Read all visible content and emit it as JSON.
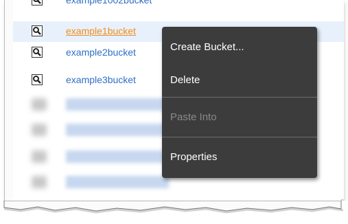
{
  "buckets": [
    {
      "name": "example1002bucket"
    },
    {
      "name": "example1bucket",
      "selected": true
    },
    {
      "name": "example2bucket"
    },
    {
      "name": "example3bucket"
    }
  ],
  "context_menu": {
    "create_bucket": "Create Bucket...",
    "delete": "Delete",
    "paste_into": "Paste Into",
    "properties": "Properties"
  },
  "icons": {
    "bucket_row": "magnifier-document-icon"
  },
  "colors": {
    "link": "#2f6fc6",
    "selected_link": "#f08c1c",
    "selection_bg": "#e8f1fb",
    "menu_bg": "#3c3c3c"
  }
}
